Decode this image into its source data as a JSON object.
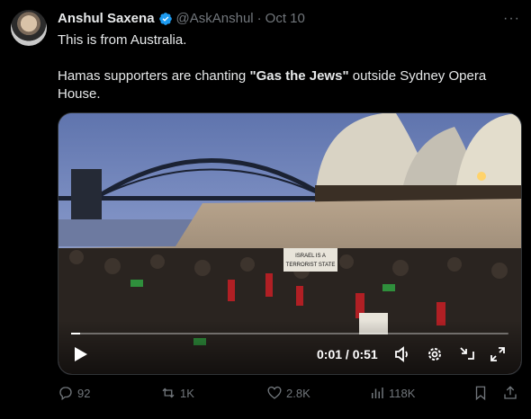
{
  "tweet": {
    "author_name": "Anshul Saxena",
    "handle": "@AskAnshul",
    "separator": "·",
    "date": "Oct 10",
    "text_line1": "This is from Australia.",
    "text_line2_prefix": "Hamas supporters are chanting ",
    "text_line2_bold": "\"Gas the Jews\"",
    "text_line2_suffix": " outside Sydney Opera House.",
    "more_label": "···"
  },
  "media": {
    "banner_text": "ISRAEL IS A TERRORIST STATE",
    "current_time": "0:01",
    "duration": "0:51",
    "time_display": "0:01 / 0:51",
    "progress": 0.02,
    "icons": [
      "play-icon",
      "volume-icon",
      "settings-icon",
      "minimize-icon",
      "fullscreen-icon"
    ]
  },
  "actions": {
    "replies": "92",
    "reposts": "1K",
    "likes": "2.8K",
    "views": "118K"
  },
  "colors": {
    "background": "#000000",
    "text": "#e7e9ea",
    "muted": "#71767b",
    "verified": "#1d9bf0"
  }
}
